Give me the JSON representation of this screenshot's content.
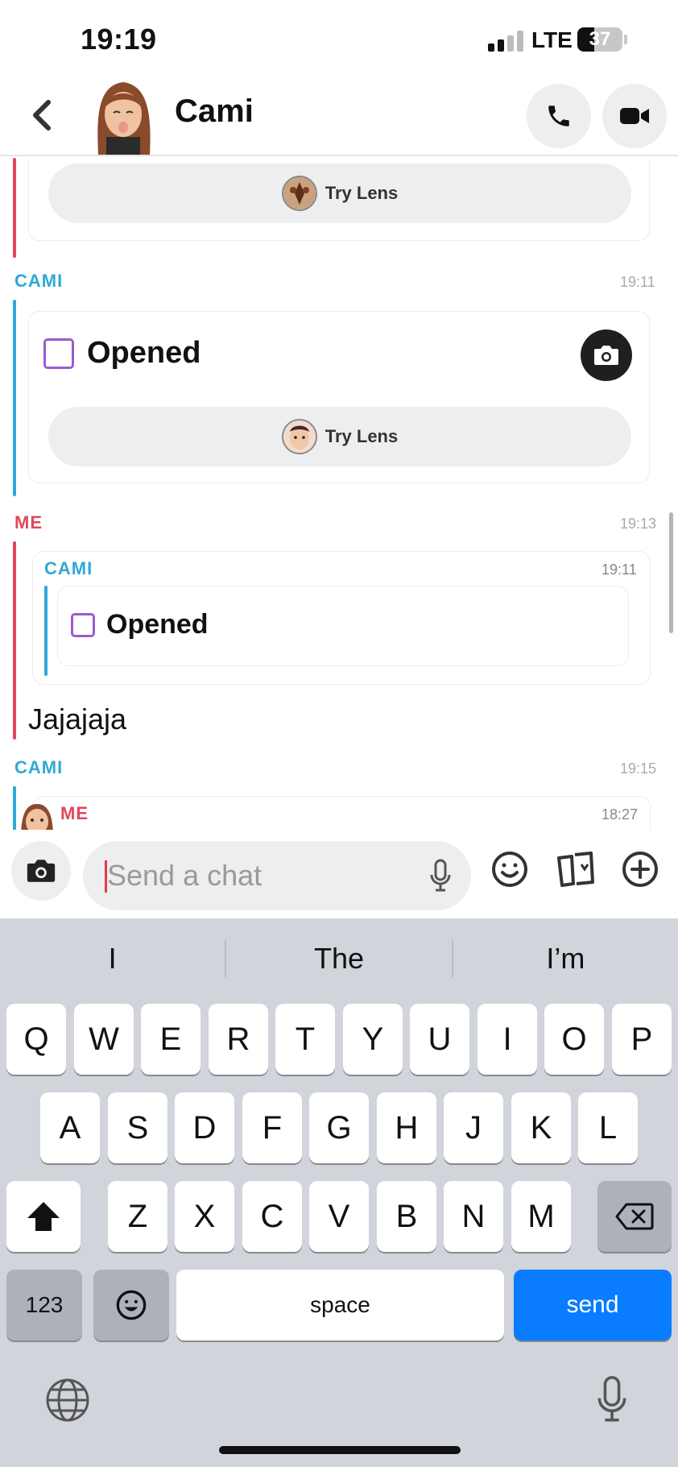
{
  "status_bar": {
    "time": "19:19",
    "network": "LTE",
    "battery": "37",
    "battery_level": 0.37
  },
  "header": {
    "contact_name": "Cami",
    "icons": [
      "back-chevron-icon",
      "phone-icon",
      "video-icon"
    ]
  },
  "chat": {
    "card1": {
      "pill_label": "Try Lens"
    },
    "msg2": {
      "sender": "CAMI",
      "time": "19:11",
      "status": "Opened",
      "pill_label": "Try Lens"
    },
    "msg3": {
      "sender": "ME",
      "time": "19:13",
      "quote": {
        "sender": "CAMI",
        "time": "19:11",
        "status": "Opened"
      },
      "text": "Jajajaja"
    },
    "msg4": {
      "sender": "CAMI",
      "time": "19:15",
      "nested_sender": "ME",
      "nested_time": "18:27"
    }
  },
  "composer": {
    "placeholder": "Send a chat",
    "icons": [
      "camera-icon",
      "microphone-icon",
      "emoji-icon",
      "cards-icon",
      "plus-icon"
    ]
  },
  "keyboard": {
    "suggestions": [
      "I",
      "The",
      "I’m"
    ],
    "row1": [
      "Q",
      "W",
      "E",
      "R",
      "T",
      "Y",
      "U",
      "I",
      "O",
      "P"
    ],
    "row2": [
      "A",
      "S",
      "D",
      "F",
      "G",
      "H",
      "J",
      "K",
      "L"
    ],
    "row3": [
      "Z",
      "X",
      "C",
      "V",
      "B",
      "N",
      "M"
    ],
    "numbers_label": "123",
    "space_label": "space",
    "send_label": "send"
  },
  "colors": {
    "cami": "#2ea9d6",
    "me": "#e0475b",
    "opened": "#9a5bd0",
    "send": "#0a7cff"
  }
}
